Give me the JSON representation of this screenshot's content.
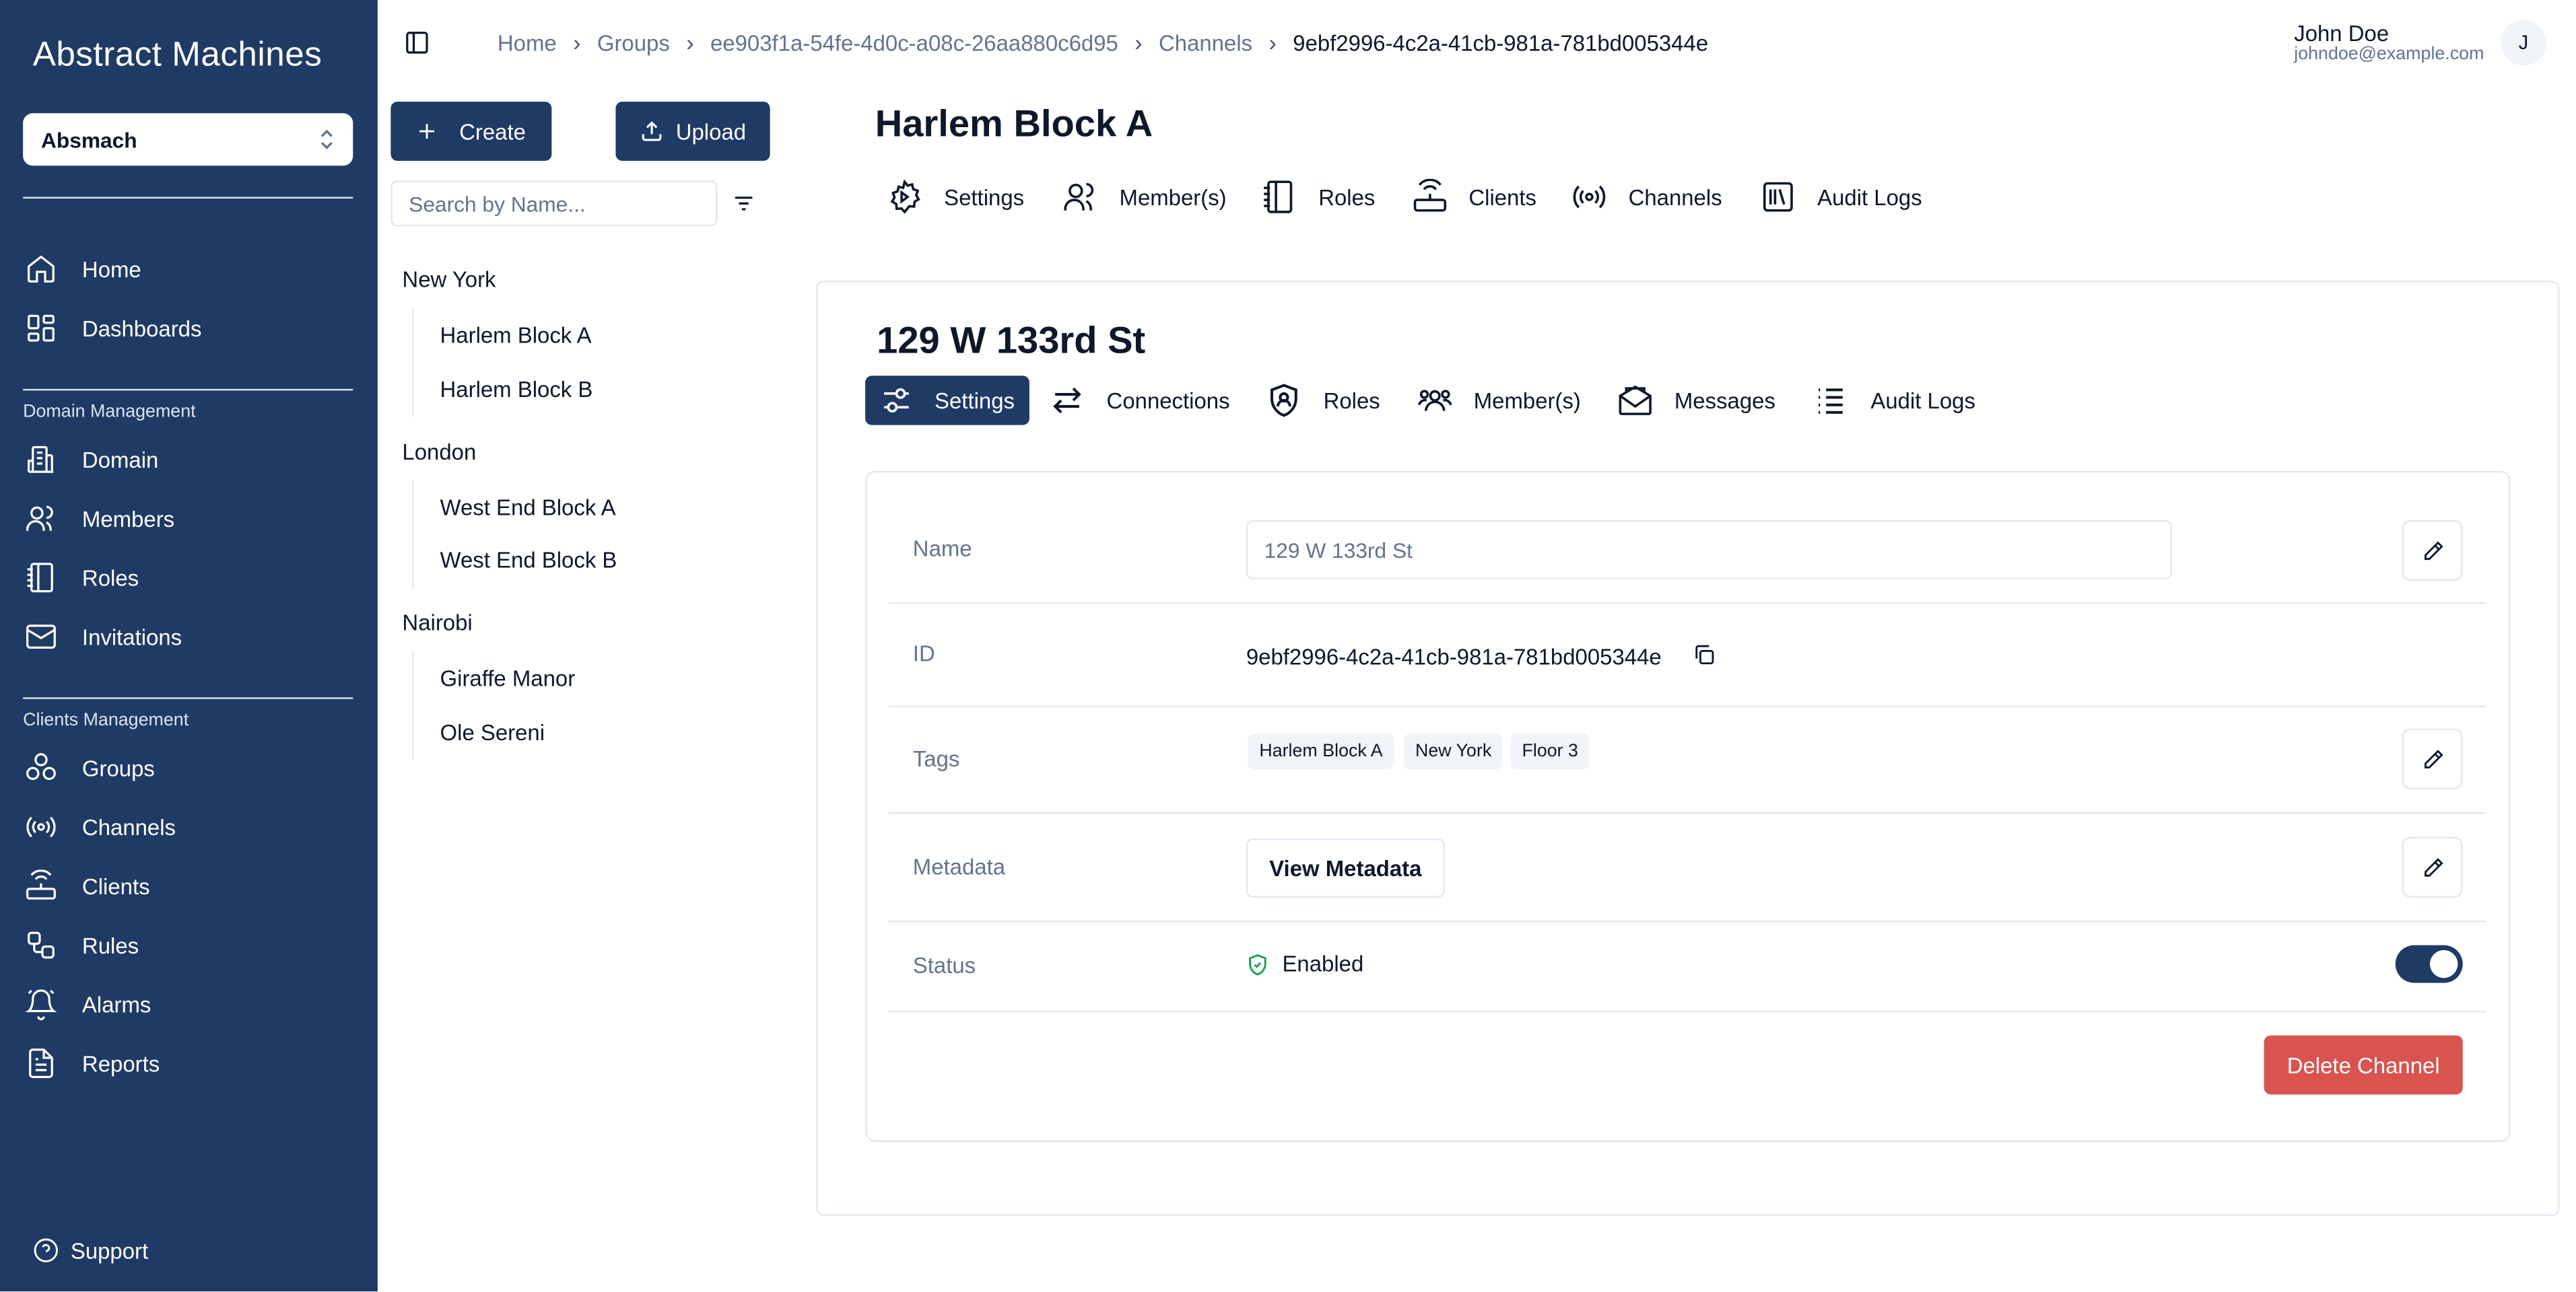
{
  "app": {
    "logo_text": "Abstract Machines"
  },
  "sidebar": {
    "domain_select": "Absmach",
    "top_items": [
      {
        "label": "Home",
        "icon": "home-icon"
      },
      {
        "label": "Dashboards",
        "icon": "dashboard-icon"
      }
    ],
    "domain_heading": "Domain Management",
    "domain_items": [
      {
        "label": "Domain",
        "icon": "building-icon"
      },
      {
        "label": "Members",
        "icon": "users-icon"
      },
      {
        "label": "Roles",
        "icon": "notebook-icon"
      },
      {
        "label": "Invitations",
        "icon": "mail-icon"
      }
    ],
    "clients_heading": "Clients Management",
    "clients_items": [
      {
        "label": "Groups",
        "icon": "groups-icon"
      },
      {
        "label": "Channels",
        "icon": "radio-icon"
      },
      {
        "label": "Clients",
        "icon": "router-icon"
      },
      {
        "label": "Rules",
        "icon": "workflow-icon"
      },
      {
        "label": "Alarms",
        "icon": "bell-icon"
      },
      {
        "label": "Reports",
        "icon": "report-icon"
      }
    ],
    "support": "Support"
  },
  "breadcrumb": [
    "Home",
    "Groups",
    "ee903f1a-54fe-4d0c-a08c-26aa880c6d95",
    "Channels",
    "9ebf2996-4c2a-41cb-981a-781bd005344e"
  ],
  "user": {
    "name": "John Doe",
    "email": "johndoe@example.com",
    "initial": "J"
  },
  "groups_panel": {
    "create_label": "Create",
    "upload_label": "Upload",
    "search_placeholder": "Search by Name...",
    "tree": [
      {
        "label": "New York",
        "children": [
          "Harlem Block A",
          "Harlem Block B"
        ]
      },
      {
        "label": "London",
        "children": [
          "West End Block A",
          "West End Block B"
        ]
      },
      {
        "label": "Nairobi",
        "children": [
          "Giraffe Manor",
          "Ole Sereni"
        ]
      }
    ]
  },
  "group": {
    "title": "Harlem Block A",
    "tabs": [
      {
        "label": "Settings",
        "icon": "settings-icon"
      },
      {
        "label": "Member(s)",
        "icon": "users-icon"
      },
      {
        "label": "Roles",
        "icon": "notebook-icon"
      },
      {
        "label": "Clients",
        "icon": "router-icon"
      },
      {
        "label": "Channels",
        "icon": "radio-icon"
      },
      {
        "label": "Audit Logs",
        "icon": "library-icon"
      }
    ]
  },
  "channel": {
    "title": "129 W 133rd St",
    "tabs": [
      {
        "label": "Settings",
        "icon": "sliders-icon",
        "active": true
      },
      {
        "label": "Connections",
        "icon": "arrows-icon"
      },
      {
        "label": "Roles",
        "icon": "shield-user-icon"
      },
      {
        "label": "Member(s)",
        "icon": "team-icon"
      },
      {
        "label": "Messages",
        "icon": "mail-open-icon"
      },
      {
        "label": "Audit Logs",
        "icon": "list-icon"
      }
    ],
    "fields": {
      "name_label": "Name",
      "name_value": "129 W 133rd St",
      "id_label": "ID",
      "id_value": "9ebf2996-4c2a-41cb-981a-781bd005344e",
      "tags_label": "Tags",
      "tags": [
        "Harlem Block A",
        "New York",
        "Floor 3"
      ],
      "metadata_label": "Metadata",
      "metadata_button": "View Metadata",
      "status_label": "Status",
      "status_value": "Enabled",
      "status_on": true
    },
    "delete_label": "Delete Channel"
  }
}
